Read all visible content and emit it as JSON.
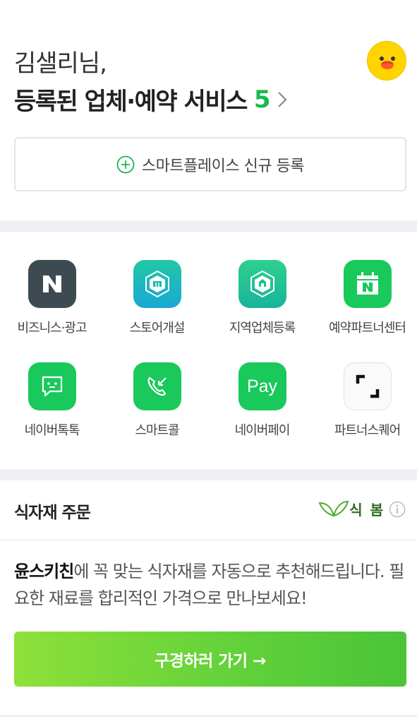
{
  "header": {
    "greeting": "김샐리님,",
    "services_label": "등록된 업체·예약 서비스",
    "services_count": "5",
    "avatar_icon": "sally-avatar-icon"
  },
  "register": {
    "label": "스마트플레이스 신규 등록",
    "icon": "plus-circle-icon"
  },
  "grid": {
    "items": [
      {
        "label": "비즈니스·광고",
        "icon": "naver-n-icon"
      },
      {
        "label": "스토어개설",
        "icon": "store-cube-icon"
      },
      {
        "label": "지역업체등록",
        "icon": "local-business-cube-icon"
      },
      {
        "label": "예약파트너센터",
        "icon": "calendar-n-icon"
      },
      {
        "label": "네이버톡톡",
        "icon": "chat-bubble-icon"
      },
      {
        "label": "스마트콜",
        "icon": "phone-call-icon"
      },
      {
        "label": "네이버페이",
        "icon_text": "Pay",
        "icon": "pay-icon"
      },
      {
        "label": "파트너스퀘어",
        "icon": "square-frame-icon"
      }
    ]
  },
  "food": {
    "title": "식자재 주문",
    "brand": "식 봄",
    "desc_strong": "윤스키친",
    "desc_rest": "에 꼭 맞는 식자재를 자동으로 추천해드립니다. 필요한 재료를 합리적인 가격으로 만나보세요!",
    "cta_label": "구경하러 가기 →"
  },
  "colors": {
    "accent_green": "#1bb84e",
    "divider": "#eef0f3",
    "cta_start": "#8fe03a",
    "cta_end": "#4bc437"
  }
}
